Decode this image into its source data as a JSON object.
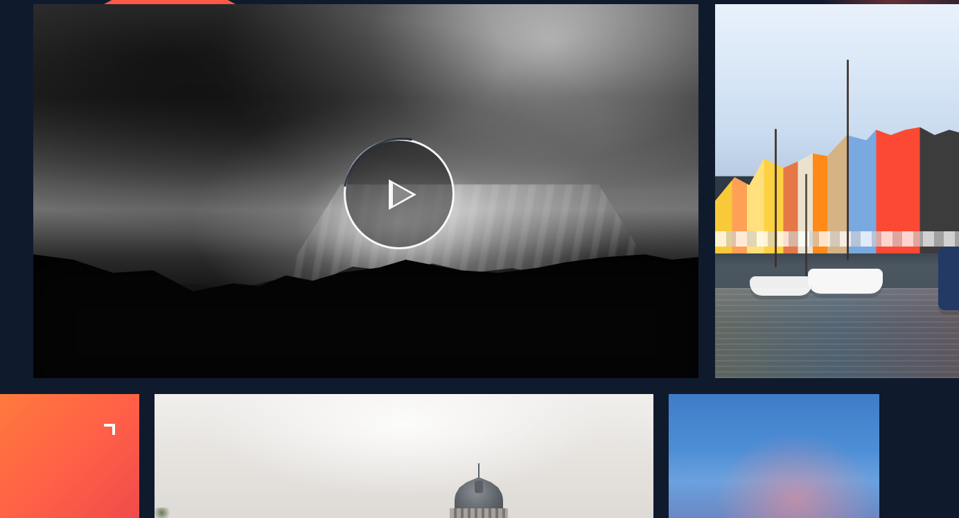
{
  "gallery": {
    "tiles": [
      {
        "id": "video-storm",
        "type": "video",
        "play_icon": "play-icon"
      },
      {
        "id": "photo-nyhavn",
        "type": "image"
      },
      {
        "id": "promo-orange",
        "type": "promo",
        "icon": "corner-arrow-icon"
      },
      {
        "id": "photo-dome",
        "type": "image"
      },
      {
        "id": "photo-sky",
        "type": "image"
      }
    ]
  },
  "colors": {
    "background": "#0f1a2d",
    "accent": "#ff5a43",
    "promo_gradient_start": "#ff7a3d",
    "promo_gradient_end": "#f04b4b"
  }
}
